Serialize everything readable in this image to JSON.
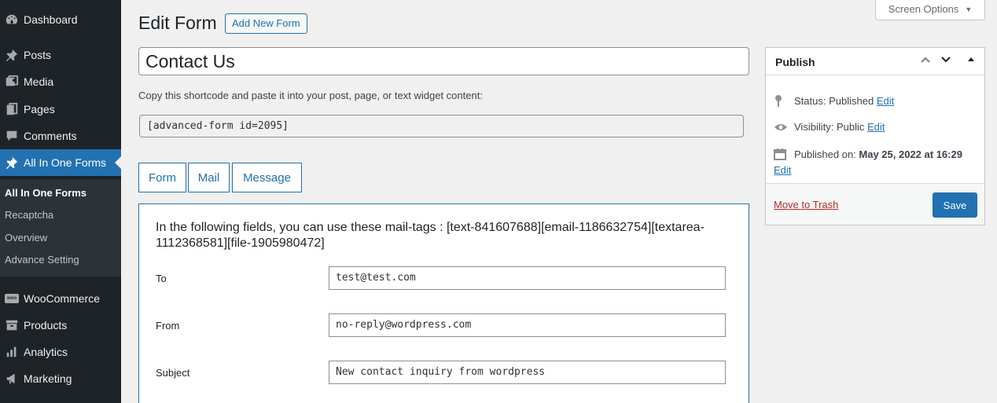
{
  "sidebar": {
    "items": [
      {
        "label": "Dashboard",
        "icon": "dashboard-icon"
      },
      {
        "label": "Posts",
        "icon": "pin-icon"
      },
      {
        "label": "Media",
        "icon": "media-icon"
      },
      {
        "label": "Pages",
        "icon": "pages-icon"
      },
      {
        "label": "Comments",
        "icon": "comment-icon"
      },
      {
        "label": "All In One Forms",
        "icon": "pin-icon"
      },
      {
        "label": "WooCommerce",
        "icon": "woo-icon"
      },
      {
        "label": "Products",
        "icon": "archive-icon"
      },
      {
        "label": "Analytics",
        "icon": "bar-chart-icon"
      },
      {
        "label": "Marketing",
        "icon": "megaphone-icon"
      }
    ],
    "submenu": [
      "All In One Forms",
      "Recaptcha",
      "Overview",
      "Advance Setting"
    ],
    "woo_badge": "woo"
  },
  "header": {
    "title": "Edit Form",
    "add_new": "Add New Form",
    "screen_options": "Screen Options",
    "screen_options_arrow": "▼"
  },
  "form": {
    "title_value": "Contact Us",
    "shortcode_desc": "Copy this shortcode and paste it into your post, page, or text widget content:",
    "shortcode_value": "[advanced-form id=2095]"
  },
  "tabs": [
    "Form",
    "Mail",
    "Message"
  ],
  "mail": {
    "mailtags": "In the following fields, you can use these mail-tags : [text-841607688][email-1186632754][textarea-1112368581][file-1905980472]",
    "fields": [
      {
        "label": "To",
        "value": "test@test.com"
      },
      {
        "label": "From",
        "value": "no-reply@wordpress.com"
      },
      {
        "label": "Subject",
        "value": "New contact inquiry from wordpress"
      }
    ]
  },
  "publish": {
    "title": "Publish",
    "status_label": "Status: Published",
    "visibility_label": "Visibility: Public",
    "published_on_label": "Published on:",
    "published_on_value": "May 25, 2022 at 16:29",
    "edit": "Edit",
    "trash": "Move to Trash",
    "save": "Save"
  },
  "colors": {
    "accent": "#2271b1",
    "sidebar_bg": "#1d2327",
    "trash": "#b32d2e"
  }
}
